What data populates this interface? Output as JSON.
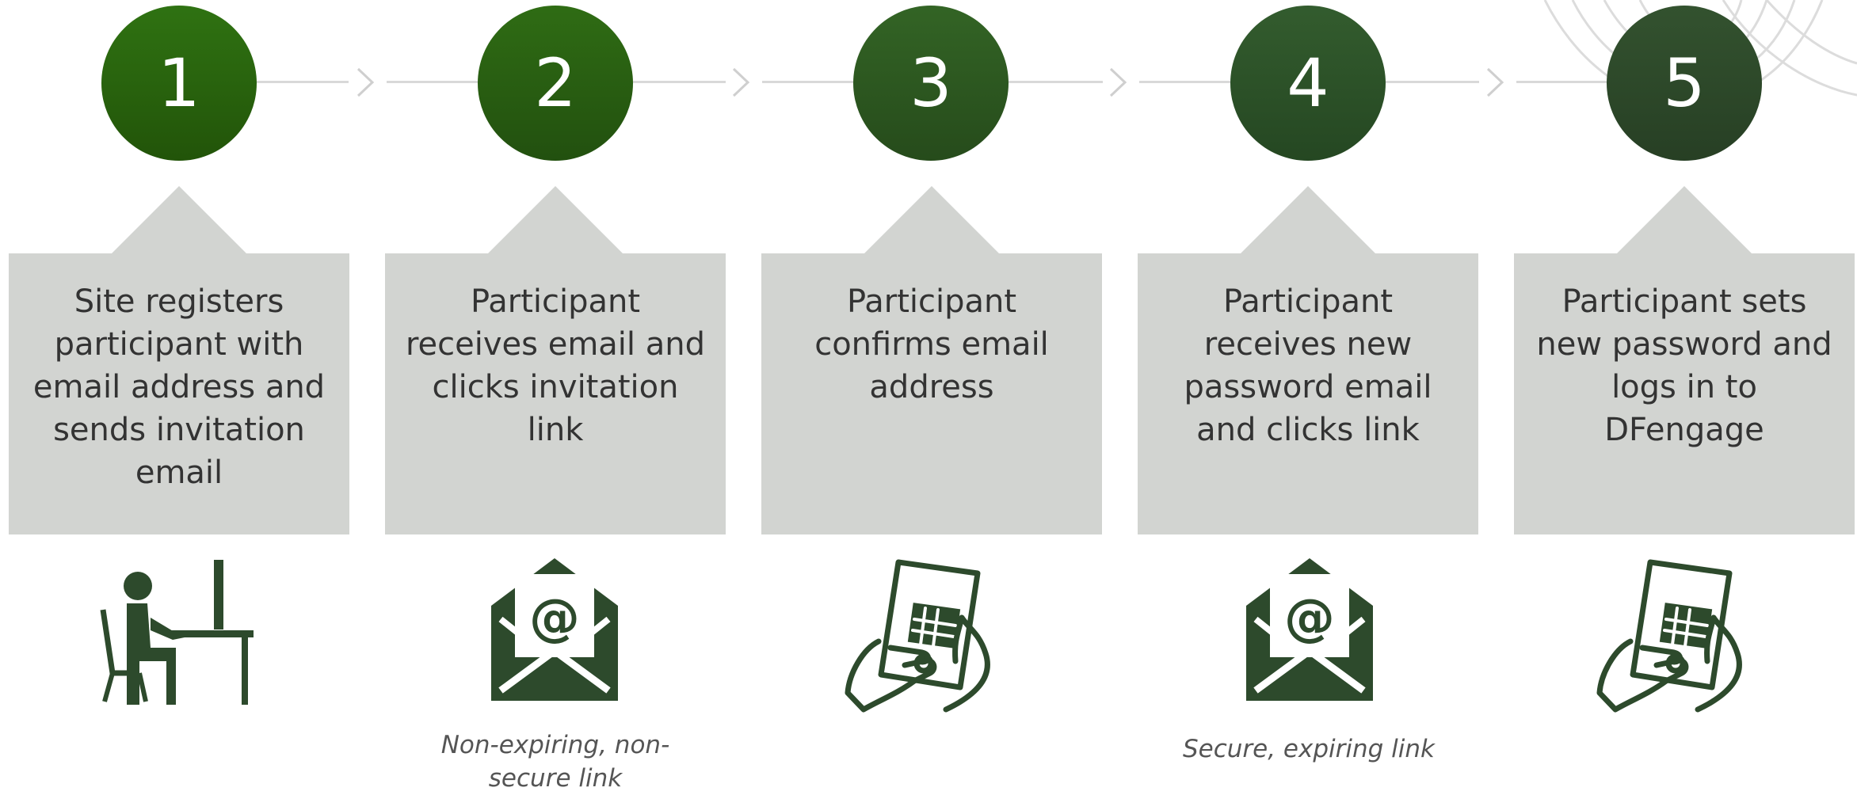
{
  "colors": {
    "circles": [
      "#28620f",
      "#2a5c18",
      "#2e5722",
      "#2d522b",
      "#2d4a2c"
    ],
    "card_bg": "#d2d4d1",
    "icon": "#2d4a2c",
    "connector": "#d9d9d9"
  },
  "steps": [
    {
      "number": "1",
      "description": "Site registers participant with email address and sends invitation email",
      "icon": "person-at-computer-icon",
      "note": ""
    },
    {
      "number": "2",
      "description": "Participant receives email and clicks invitation link",
      "icon": "email-envelope-icon",
      "note": "Non-expiring, non-secure link"
    },
    {
      "number": "3",
      "description": "Participant confirms email address",
      "icon": "tablet-hands-icon",
      "note": ""
    },
    {
      "number": "4",
      "description": "Participant receives new password email and clicks link",
      "icon": "email-envelope-icon",
      "note": "Secure, expiring link"
    },
    {
      "number": "5",
      "description": "Participant sets new password and logs in to DFengage",
      "icon": "tablet-hands-icon",
      "note": ""
    }
  ]
}
